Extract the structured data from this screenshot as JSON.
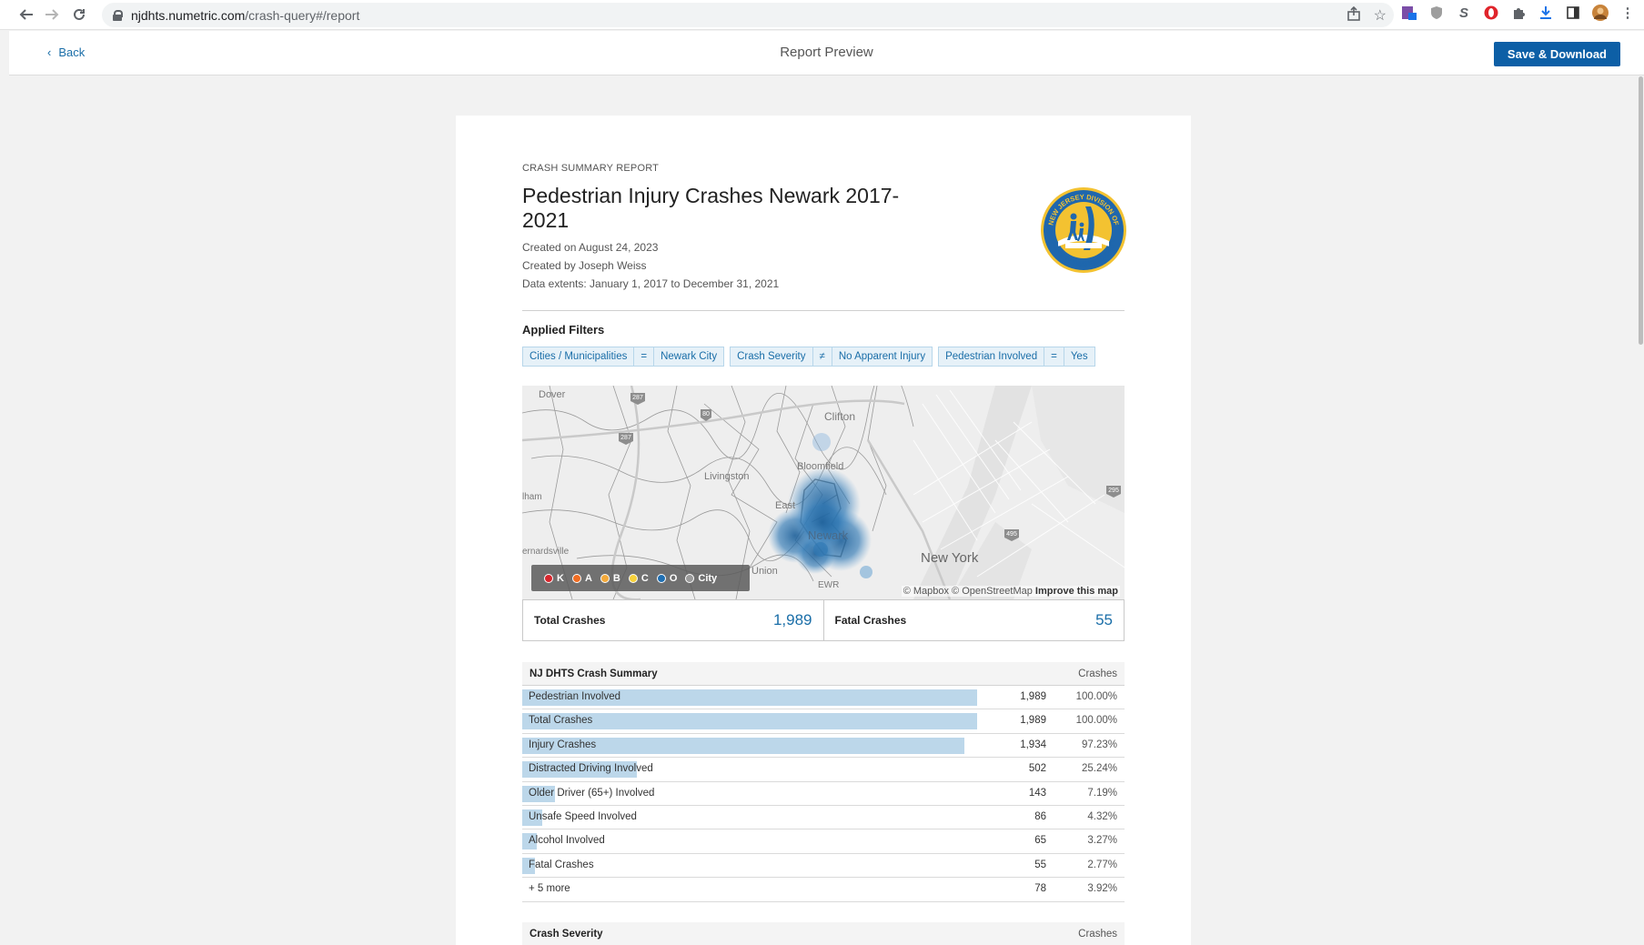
{
  "browser": {
    "url_host": "njdhts.numetric.com",
    "url_path": "/crash-query#/report"
  },
  "header": {
    "back_label": "Back",
    "title": "Report Preview",
    "save_label": "Save & Download"
  },
  "report": {
    "kicker": "CRASH SUMMARY REPORT",
    "title": "Pedestrian Injury Crashes Newark 2017-2021",
    "created_on": "Created on August 24, 2023",
    "created_by": "Created by Joseph Weiss",
    "data_extents": "Data extents: January 1, 2017 to December 31, 2021",
    "logo_text_top": "NEW JERSEY DIVISION OF",
    "logo_text_bottom": "HIGHWAY TRAFFIC SAFETY"
  },
  "filters": {
    "title": "Applied Filters",
    "items": [
      {
        "field": "Cities / Municipalities",
        "op": "=",
        "value": "Newark City"
      },
      {
        "field": "Crash Severity",
        "op": "≠",
        "value": "No Apparent Injury"
      },
      {
        "field": "Pedestrian Involved",
        "op": "=",
        "value": "Yes"
      }
    ]
  },
  "map": {
    "place_labels": {
      "dover": "Dover",
      "clifton": "Clifton",
      "bloomfield": "Bloomfield",
      "livingston": "Livingston",
      "east": "East",
      "newark": "Newark",
      "union": "Union",
      "ewr": "EWR",
      "new_york": "New York",
      "hanover": "lham",
      "bernardsville": "ernardsville"
    },
    "shields": [
      "287",
      "287",
      "80",
      "495",
      "295"
    ],
    "legend": [
      {
        "label": "K",
        "color": "#d7262d"
      },
      {
        "label": "A",
        "color": "#ef6c22"
      },
      {
        "label": "B",
        "color": "#f4a93a"
      },
      {
        "label": "C",
        "color": "#f6d13b"
      },
      {
        "label": "O",
        "color": "#1f6fb2"
      },
      {
        "label": "City",
        "color": "#9a9a9a"
      }
    ],
    "attribution": "© Mapbox © OpenStreetMap",
    "improve_link": "Improve this map"
  },
  "stats": {
    "total_label": "Total Crashes",
    "total_value": "1,989",
    "fatal_label": "Fatal Crashes",
    "fatal_value": "55"
  },
  "summary_table": {
    "title": "NJ DHTS Crash Summary",
    "column_label": "Crashes",
    "rows": [
      {
        "label": "Pedestrian Involved",
        "count": "1,989",
        "pct": "100.00%",
        "fraction": 1.0
      },
      {
        "label": "Total Crashes",
        "count": "1,989",
        "pct": "100.00%",
        "fraction": 1.0
      },
      {
        "label": "Injury Crashes",
        "count": "1,934",
        "pct": "97.23%",
        "fraction": 0.9723
      },
      {
        "label": "Distracted Driving Involved",
        "count": "502",
        "pct": "25.24%",
        "fraction": 0.2524
      },
      {
        "label": "Older Driver (65+) Involved",
        "count": "143",
        "pct": "7.19%",
        "fraction": 0.0719
      },
      {
        "label": "Unsafe Speed Involved",
        "count": "86",
        "pct": "4.32%",
        "fraction": 0.0432
      },
      {
        "label": "Alcohol Involved",
        "count": "65",
        "pct": "3.27%",
        "fraction": 0.0327
      },
      {
        "label": "Fatal Crashes",
        "count": "55",
        "pct": "2.77%",
        "fraction": 0.0277
      },
      {
        "label": "+ 5 more",
        "count": "78",
        "pct": "3.92%",
        "fraction": 0
      }
    ]
  },
  "severity_table": {
    "title": "Crash Severity",
    "column_label": "Crashes"
  }
}
